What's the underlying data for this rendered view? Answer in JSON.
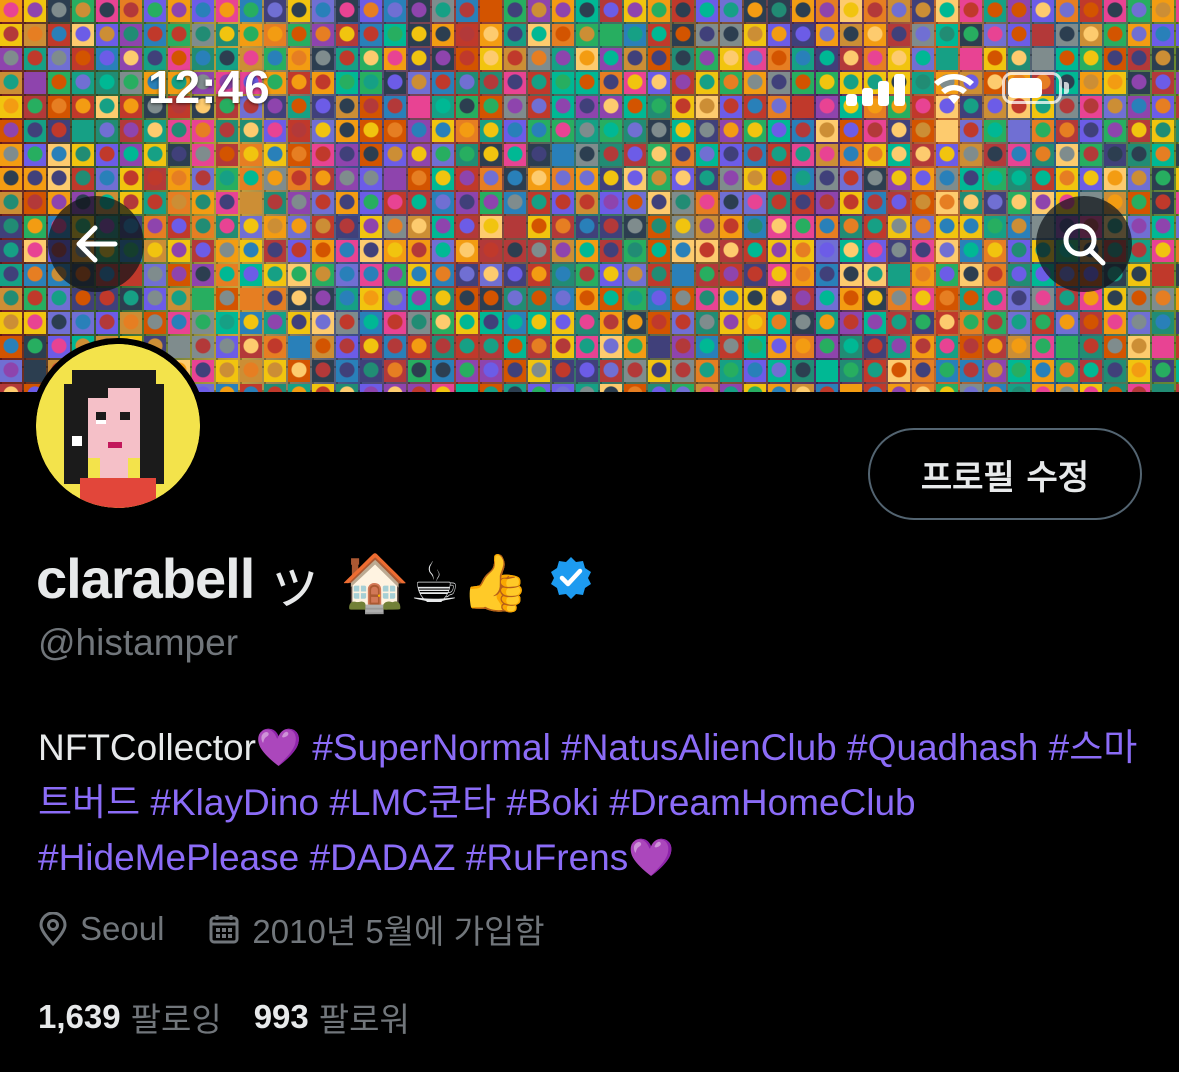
{
  "status_bar": {
    "time": "12:46",
    "signal_icon": "cellular-signal-icon",
    "wifi_icon": "wifi-icon",
    "battery_icon": "battery-icon"
  },
  "header": {
    "back_icon": "arrow-left-icon",
    "search_icon": "search-icon"
  },
  "profile": {
    "display_name": "clarabell",
    "name_emoji": "ッ 🏠☕👍",
    "handle": "@histamper",
    "edit_button_label": "프로필 수정",
    "bio_text": "NFTCollector",
    "bio_heart_1": "💜",
    "bio_tags": [
      "#SuperNormal",
      "#NatusAlienClub",
      "#Quadhash",
      "#스마트버드",
      "#KlayDino",
      "#LMC쿤타",
      "#Boki",
      "#DreamHomeClub",
      "#HideMePlease",
      "#DADAZ",
      "#RuFrens"
    ],
    "bio_heart_2": "💜",
    "location": "Seoul",
    "joined": "2010년 5월에 가입함",
    "following_count": "1,639",
    "following_label": "팔로잉",
    "followers_count": "993",
    "followers_label": "팔로워"
  },
  "colors": {
    "background": "#000000",
    "text": "#e7e9ea",
    "secondary": "#71767b",
    "hashtag": "#8b6cf7",
    "verified": "#1d9bf0",
    "avatar_bg": "#f3e34b"
  }
}
